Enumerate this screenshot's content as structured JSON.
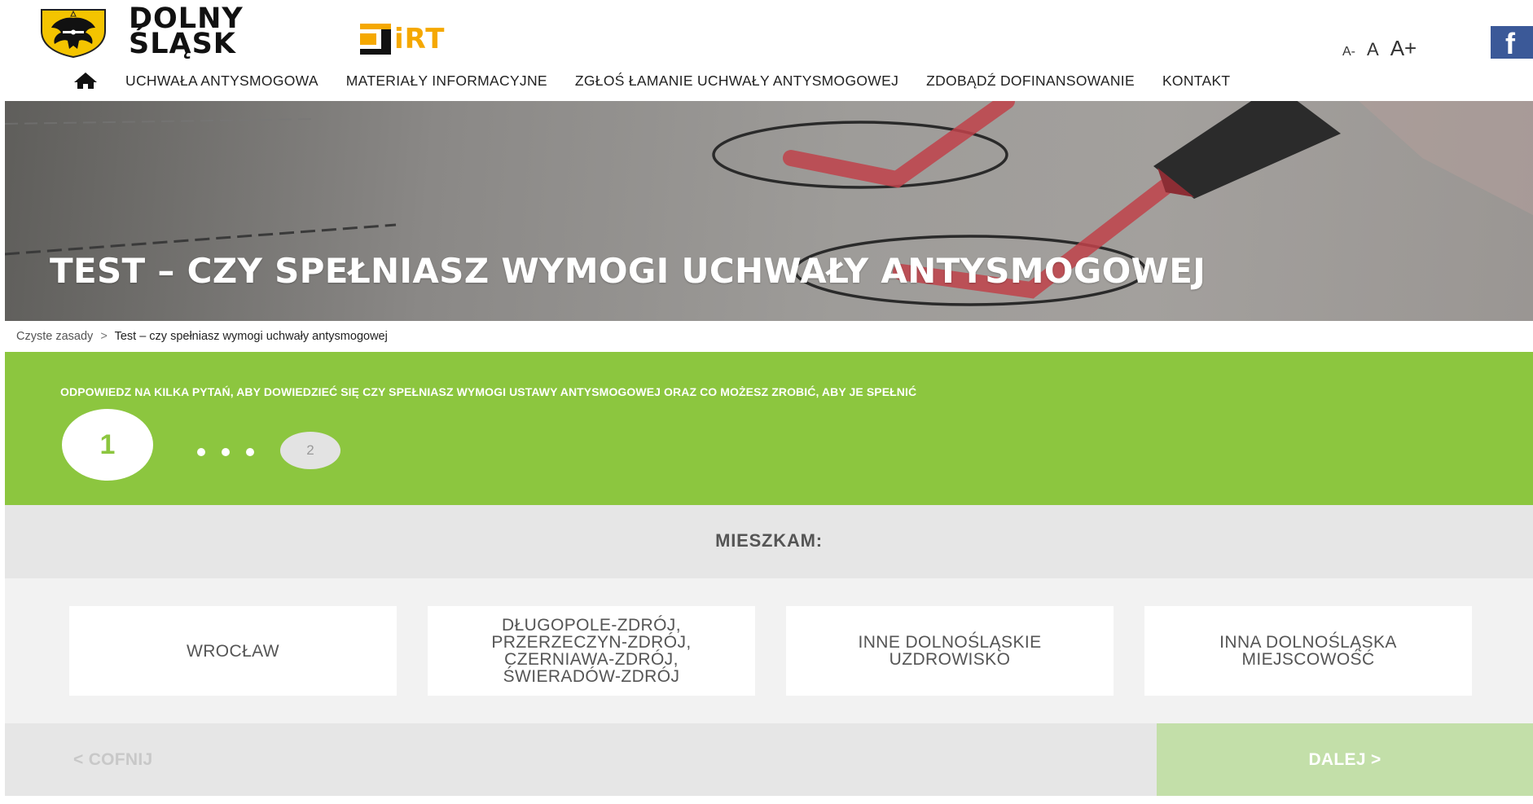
{
  "header": {
    "logo_line1": "DOLNY",
    "logo_line2": "ŚLĄSK",
    "partner_logo": "iRT",
    "font_size_controls": [
      "A-",
      "A",
      "A+"
    ],
    "facebook_icon": "f"
  },
  "nav": {
    "home_icon": "home-icon",
    "items": [
      "UCHWAŁA ANTYSMOGOWA",
      "MATERIAŁY INFORMACYJNE",
      "ZGŁOŚ ŁAMANIE UCHWAŁY ANTYSMOGOWEJ",
      "ZDOBĄDŹ DOFINANSOWANIE",
      "KONTAKT"
    ]
  },
  "hero": {
    "title": "TEST – CZY SPEŁNIASZ WYMOGI UCHWAŁY ANTYSMOGOWEJ"
  },
  "breadcrumb": {
    "home": "Czyste zasady",
    "separator": ">",
    "current": "Test – czy spełniasz wymogi uchwały antysmogowej"
  },
  "quiz": {
    "instruction": "ODPOWIEDZ NA KILKA PYTAŃ, ABY DOWIEDZIEĆ SIĘ CZY SPEŁNIASZ WYMOGI USTAWY ANTYSMOGOWEJ ORAZ CO MOŻESZ ZROBIĆ, ABY JE SPEŁNIĆ",
    "steps": [
      "1",
      "2"
    ],
    "question": "MIESZKAM:",
    "options": [
      "WROCŁAW",
      "DŁUGOPOLE-ZDRÓJ,\nPRZERZECZYN-ZDRÓJ,\nCZERNIAWA-ZDRÓJ,\nŚWIERADÓW-ZDRÓJ",
      "INNE DOLNOŚLĄSKIE\nUZDROWISKO",
      "INNA DOLNOŚLĄSKA\nMIEJSCOWOŚĆ"
    ],
    "back_label": "< COFNIJ",
    "next_label": "DALEJ >"
  },
  "colors": {
    "accent_green": "#8cc63f",
    "next_disabled": "#c3dfa9",
    "facebook": "#3b5998",
    "irt_orange": "#f5a800"
  }
}
